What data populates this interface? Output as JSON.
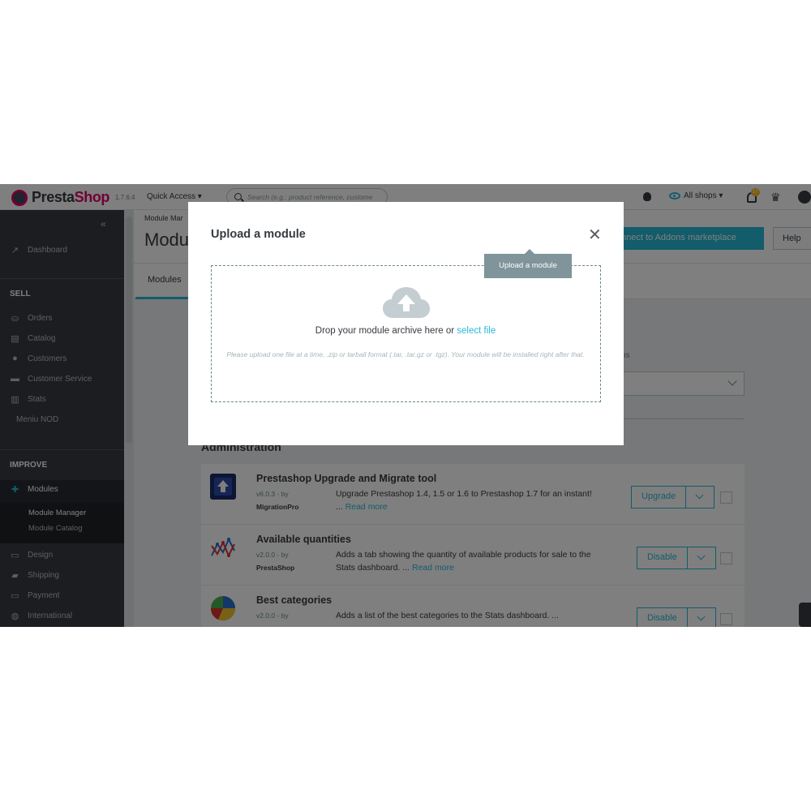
{
  "header": {
    "logo_prefix": "Presta",
    "logo_suffix": "Shop",
    "version": "1.7.6.4",
    "quick_access": "Quick Access ▾",
    "search_placeholder": "Search (e.g.: product reference, custome",
    "all_shops": "All shops ▾",
    "notification_count": "17"
  },
  "sidebar": {
    "collapse": "«",
    "dashboard": "Dashboard",
    "sell_heading": "SELL",
    "sell_items": [
      "Orders",
      "Catalog",
      "Customers",
      "Customer Service",
      "Stats"
    ],
    "custom_item": "Meniu NOD",
    "improve_heading": "IMPROVE",
    "modules": "Modules",
    "module_subitems": [
      "Module Manager",
      "Module Catalog"
    ],
    "improve_items": [
      "Design",
      "Shipping",
      "Payment",
      "International"
    ]
  },
  "toolbar": {
    "breadcrumb": "Module Mar",
    "title": "Modu",
    "addons_button": "nnect to Addons marketplace",
    "help_button": "Help"
  },
  "tabs": {
    "active": "Modules"
  },
  "filter": {
    "label": "ns"
  },
  "section": {
    "title": "Administration"
  },
  "modules": [
    {
      "name": "Prestashop Upgrade and Migrate tool",
      "version": "v6.0.3 - by",
      "author": "MigrationPro",
      "desc": "Upgrade Prestashop 1.4, 1.5 or 1.6 to Prestashop 1.7 for an instant! ... ",
      "read_more": "Read more",
      "action": "Upgrade"
    },
    {
      "name": "Available quantities",
      "version": "v2.0.0 - by",
      "author": "PrestaShop",
      "desc": "Adds a tab showing the quantity of available products for sale to the Stats dashboard. ... ",
      "read_more": "Read more",
      "action": "Disable"
    },
    {
      "name": "Best categories",
      "version": "v2.0.0 - by",
      "author": "",
      "desc": "Adds a list of the best categories to the Stats dashboard. ...",
      "read_more": "",
      "action": "Disable"
    }
  ],
  "modal": {
    "title": "Upload a module",
    "close": "✕",
    "tooltip": "Upload a module",
    "drop_text": "Drop your module archive here or ",
    "select_file": "select file",
    "hint": "Please upload one file at a time, .zip or tarball format (.tar, .tar.gz or .tgz). Your module will be installed right after that."
  },
  "icons": {
    "upload": "cloud-upload-icon",
    "close": "close-icon"
  },
  "colors": {
    "accent": "#25b9d7",
    "brand": "#df0067",
    "sidebar": "#363a41"
  }
}
